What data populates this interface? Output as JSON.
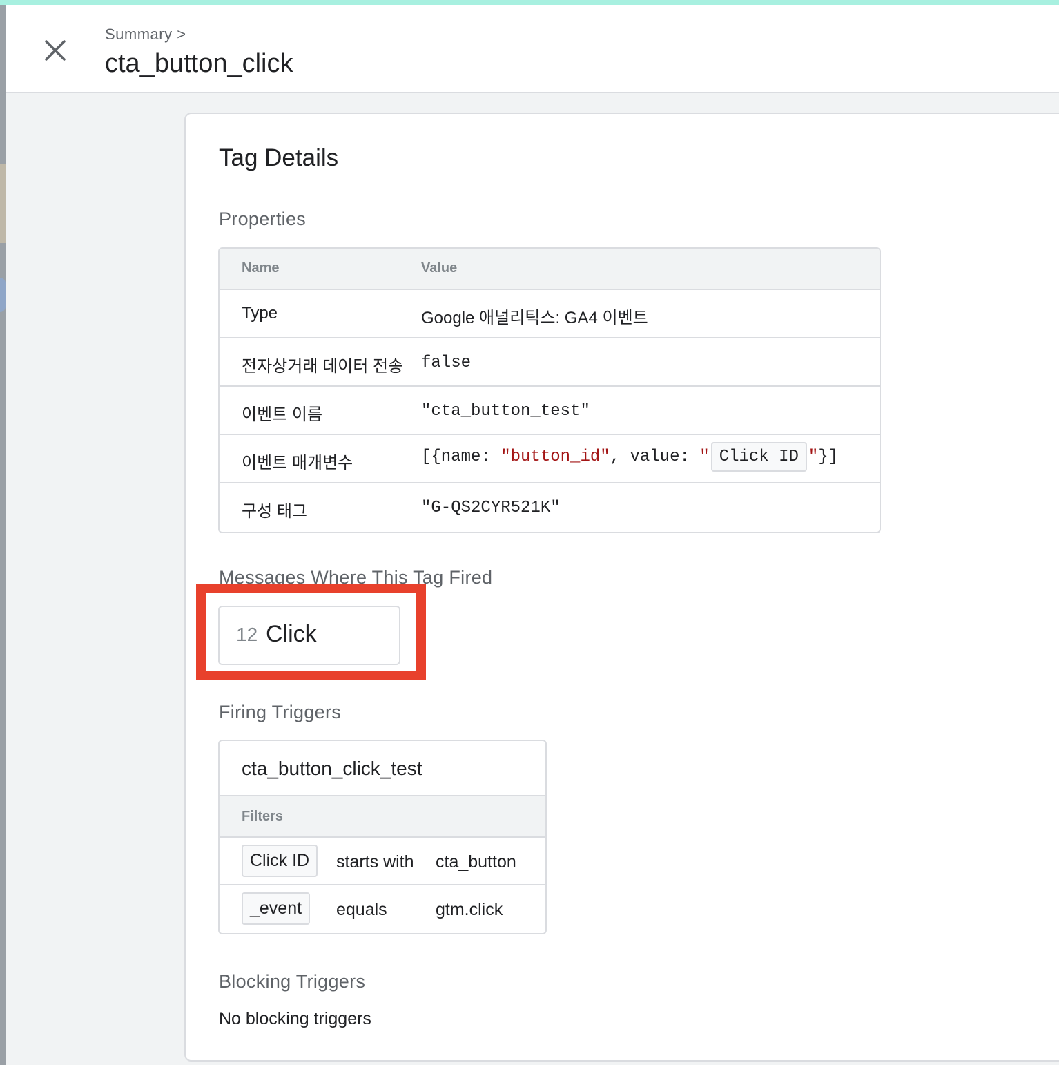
{
  "header": {
    "breadcrumb": "Summary >",
    "title": "cta_button_click"
  },
  "card": {
    "title": "Tag Details",
    "properties": {
      "heading": "Properties",
      "col_name": "Name",
      "col_value": "Value",
      "rows": [
        {
          "name": "Type",
          "value": "Google 애널리틱스: GA4 이벤트"
        },
        {
          "name": "전자상거래 데이터 전송",
          "value": "false"
        },
        {
          "name": "이벤트 이름",
          "value": "\"cta_button_test\""
        },
        {
          "name": "이벤트 매개변수",
          "value_prefix": "[{name: ",
          "value_key": "\"button_id\"",
          "value_mid": ", value: ",
          "value_quote_open": "\"",
          "value_chip": "Click ID",
          "value_quote_close": "\"",
          "value_suffix": "}]"
        },
        {
          "name": "구성 태그",
          "value": "\"G-QS2CYR521K\""
        }
      ]
    },
    "messages": {
      "heading": "Messages Where This Tag Fired",
      "items": [
        {
          "number": "12",
          "label": "Click"
        }
      ]
    },
    "firing_triggers": {
      "heading": "Firing Triggers",
      "trigger_name": "cta_button_click_test",
      "filters_label": "Filters",
      "filters": [
        {
          "variable": "Click ID",
          "operator": "starts with",
          "value": "cta_button"
        },
        {
          "variable": "_event",
          "operator": "equals",
          "value": "gtm.click"
        }
      ]
    },
    "blocking_triggers": {
      "heading": "Blocking Triggers",
      "text": "No blocking triggers"
    }
  },
  "colors": {
    "highlight": "#e8412c",
    "keyword": "#1a1aa6",
    "string": "#a31515",
    "top_accent": "#a8f0e0"
  },
  "icons": {
    "close": "close-icon"
  }
}
